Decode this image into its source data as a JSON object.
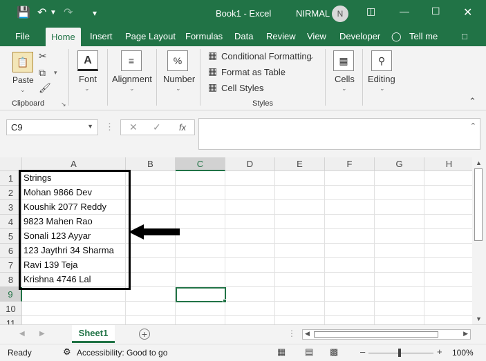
{
  "app": {
    "title": "Book1 - Excel",
    "user": "NIRMAL",
    "avatar_initial": "N",
    "accent": "#217346"
  },
  "menu": [
    "File",
    "Home",
    "Insert",
    "Page Layout",
    "Formulas",
    "Data",
    "Review",
    "View",
    "Developer",
    "Tell me"
  ],
  "ribbon": {
    "paste": "Paste",
    "clipboard": "Clipboard",
    "font": "Font",
    "font_icon": "A",
    "alignment": "Alignment",
    "number": "Number",
    "number_icon": "%",
    "conditional_formatting": "Conditional Formatting",
    "format_as_table": "Format as Table",
    "cell_styles": "Cell Styles",
    "styles": "Styles",
    "cells": "Cells",
    "editing": "Editing"
  },
  "formula_bar": {
    "name_box": "C9",
    "fx": "fx",
    "content": ""
  },
  "columns": [
    "A",
    "B",
    "C",
    "D",
    "E",
    "F",
    "G",
    "H"
  ],
  "rows": [
    "1",
    "2",
    "3",
    "4",
    "5",
    "6",
    "7",
    "8",
    "9",
    "10",
    "11"
  ],
  "cells_A": [
    "Strings",
    "Mohan 9866 Dev",
    "Koushik 2077 Reddy",
    "9823 Mahen  Rao",
    "Sonali 123 Ayyar",
    "123 Jaythri 34 Sharma",
    "Ravi 139 Teja",
    "Krishna 4746 Lal"
  ],
  "sheets": {
    "active": "Sheet1",
    "add": "+"
  },
  "status": {
    "ready": "Ready",
    "accessibility": "Accessibility: Good to go",
    "zoom": "100%"
  }
}
